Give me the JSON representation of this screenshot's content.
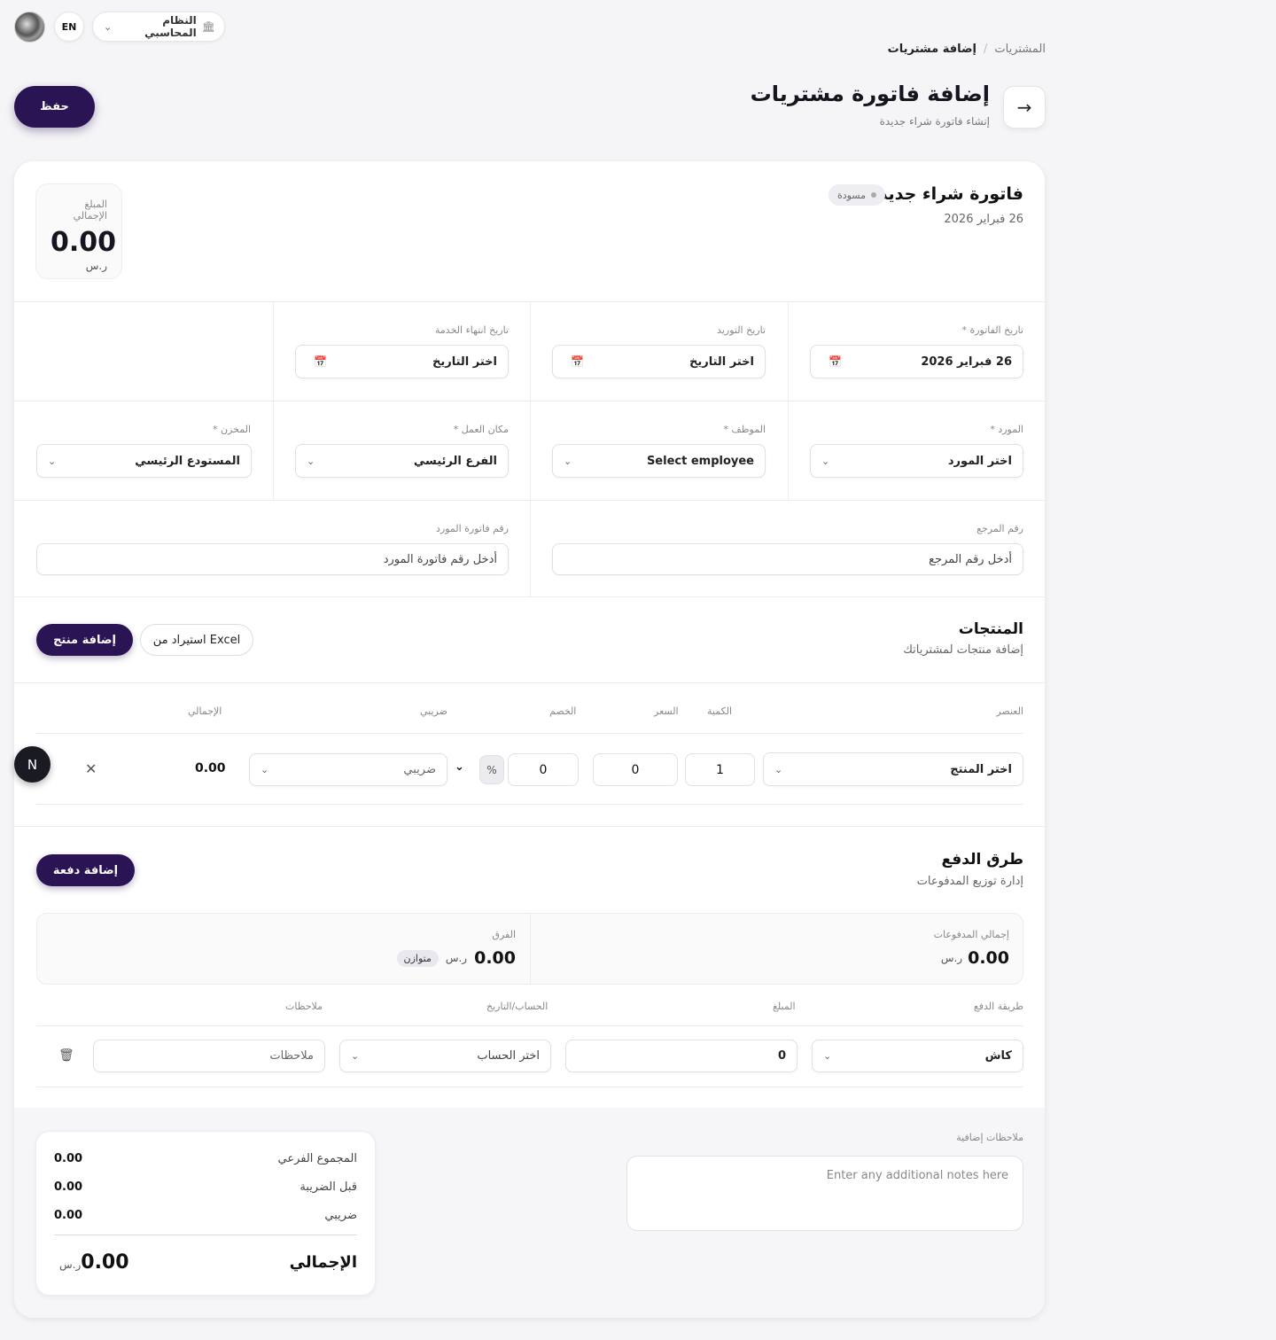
{
  "topbar": {
    "lang": "EN",
    "system_label": "النظام المحاسبي"
  },
  "breadcrumb": {
    "parent": "المشتريات",
    "separator": "/",
    "current": "إضافة مشتريات"
  },
  "header": {
    "title": "إضافة فاتورة مشتريات",
    "subtitle": "إنشاء فاتورة شراء جديدة",
    "save_label": "حفظ"
  },
  "invoice": {
    "title": "فاتورة شراء جديدة",
    "status": "مسودة",
    "date": "26 فبراير 2026",
    "total_label": "المبلغ الإجمالي",
    "total_value": "0.00",
    "currency": "ر.س"
  },
  "fields": {
    "invoice_date": {
      "label": "تاريخ الفاتورة *",
      "value": "26 فبراير 2026"
    },
    "supply_date": {
      "label": "تاريخ التوريد",
      "value": "اختر التاريخ"
    },
    "service_end_date": {
      "label": "تاريخ انتهاء الخدمة",
      "value": "اختر التاريخ"
    },
    "supplier": {
      "label": "المورد *",
      "value": "اختر المورد"
    },
    "employee": {
      "label": "الموظف *",
      "value": "Select employee"
    },
    "workplace": {
      "label": "مكان العمل *",
      "value": "الفرع الرئيسي"
    },
    "warehouse": {
      "label": "المخزن *",
      "value": "المستودع الرئيسي"
    },
    "reference": {
      "label": "رقم المرجع",
      "placeholder": "أدخل رقم المرجع"
    },
    "supplier_invoice": {
      "label": "رقم فاتورة المورد",
      "placeholder": "أدخل رقم فاتورة المورد"
    }
  },
  "products": {
    "title": "المنتجات",
    "subtitle": "إضافة منتجات لمشترياتك",
    "import_label": "استيراد من Excel",
    "add_label": "إضافة منتج",
    "columns": {
      "item": "العنصر",
      "qty": "الكمية",
      "price": "السعر",
      "discount": "الخصم",
      "tax": "ضريبي",
      "total": "الإجمالي"
    },
    "row": {
      "item": "اختر المنتج",
      "qty": "1",
      "price": "0",
      "discount": "0",
      "discount_unit": "%",
      "tax": "ضريبي",
      "total": "0.00"
    }
  },
  "payments": {
    "title": "طرق الدفع",
    "subtitle": "إدارة توزيع المدفوعات",
    "add_label": "إضافة دفعة",
    "total_paid_label": "إجمالي المدفوعات",
    "total_paid": "0.00",
    "diff_label": "الفرق",
    "diff": "0.00",
    "balanced": "متوازن",
    "currency": "ر.س",
    "columns": {
      "method": "طريقة الدفع",
      "amount": "المبلغ",
      "account": "الحساب/التاريخ",
      "notes": "ملاحظات"
    },
    "row": {
      "method": "كاش",
      "amount": "0",
      "account": "اختر الحساب",
      "notes": "ملاحظات"
    }
  },
  "notes": {
    "label": "ملاحظات إضافية",
    "placeholder": "Enter any additional notes here"
  },
  "summary": {
    "subtotal_label": "المجموع الفرعي",
    "subtotal": "0.00",
    "pretax_label": "قبل الضريبة",
    "pretax": "0.00",
    "tax_label": "ضريبي",
    "tax": "0.00",
    "total_label": "الإجمالي",
    "total": "0.00",
    "currency": "ر.س"
  },
  "floating": {
    "badge": "N"
  }
}
